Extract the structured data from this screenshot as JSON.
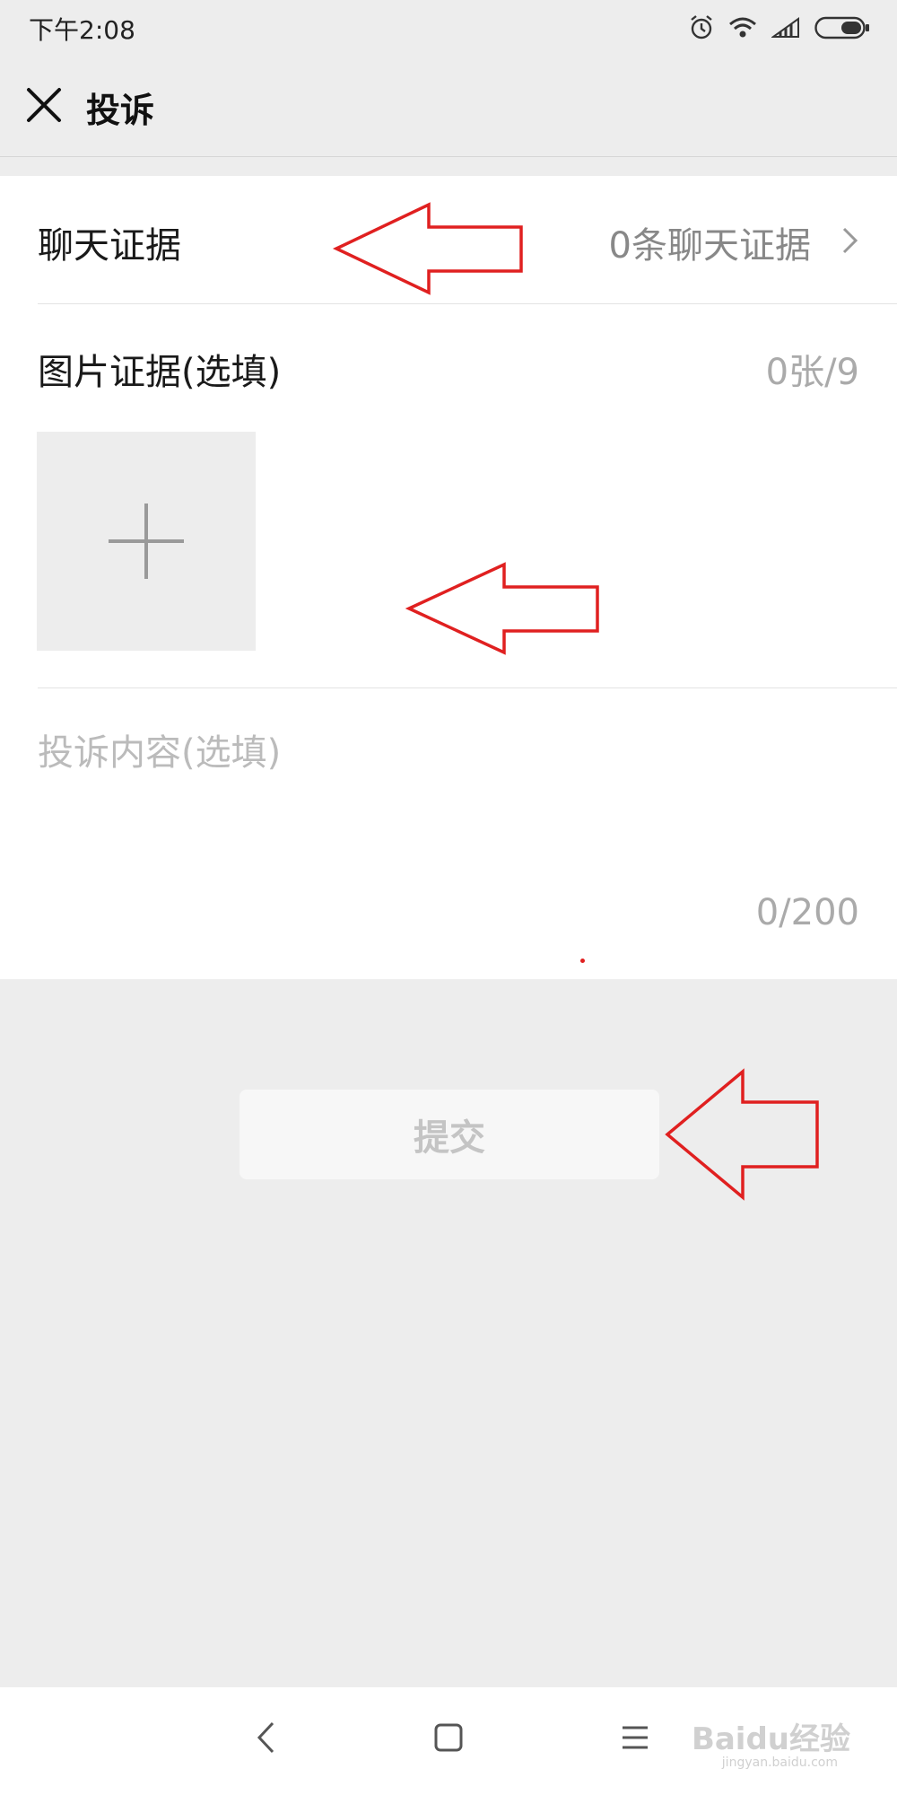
{
  "status_bar": {
    "time": "下午2:08",
    "icons": [
      "alarm-icon",
      "wifi-icon",
      "signal-icon",
      "battery-icon"
    ]
  },
  "title_bar": {
    "close_icon": "close-icon",
    "title": "投诉"
  },
  "form": {
    "chat_evidence": {
      "label": "聊天证据",
      "value": "0条聊天证据",
      "icon": "chevron-right-icon"
    },
    "image_evidence": {
      "label": "图片证据(选填)",
      "count": "0张/9",
      "add_icon": "plus-icon"
    },
    "content": {
      "placeholder": "投诉内容(选填)",
      "value": "",
      "count": "0/200"
    }
  },
  "submit": {
    "label": "提交"
  },
  "nav_bar": {
    "icons": [
      "back-icon",
      "home-icon",
      "menu-icon"
    ],
    "watermark": "Baidu经验",
    "watermark_sub": "jingyan.baidu.com"
  },
  "colors": {
    "background": "#ededed",
    "card": "#ffffff",
    "annotation_red": "#e02020",
    "muted_text": "#aaaaaa"
  }
}
